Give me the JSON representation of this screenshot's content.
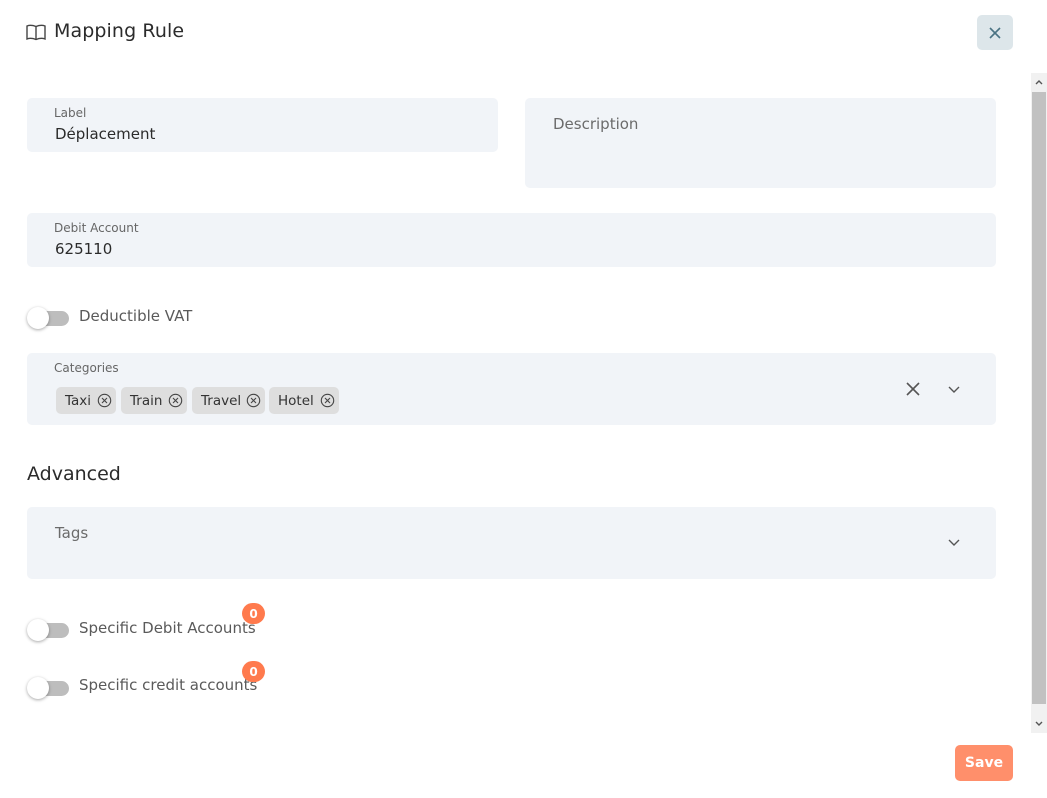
{
  "dialog": {
    "title": "Mapping Rule",
    "title_icon": "book-open-icon",
    "close_icon": "close-icon"
  },
  "form": {
    "label": {
      "label": "Label",
      "value": "Déplacement"
    },
    "description": {
      "placeholder": "Description",
      "value": ""
    },
    "debit_account": {
      "label": "Debit Account",
      "value": "625110"
    },
    "deductible_vat": {
      "label": "Deductible VAT",
      "checked": false
    },
    "categories": {
      "label": "Categories",
      "chips": [
        "Taxi",
        "Train",
        "Travel",
        "Hotel"
      ]
    }
  },
  "advanced": {
    "title": "Advanced",
    "tags": {
      "placeholder": "Tags"
    },
    "specific_debit": {
      "label": "Specific Debit Accounts",
      "count": "0",
      "checked": false
    },
    "specific_credit": {
      "label": "Specific credit accounts",
      "count": "0",
      "checked": false
    }
  },
  "actions": {
    "save_label": "Save"
  },
  "colors": {
    "field_bg": "#f1f4f8",
    "accent": "#ff7a4d",
    "save_bg": "#ff8f6b",
    "close_bg": "#dde6ea"
  }
}
